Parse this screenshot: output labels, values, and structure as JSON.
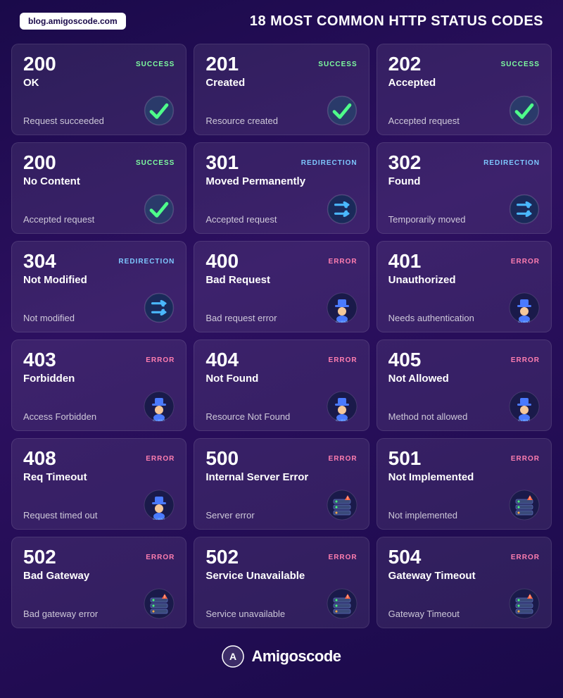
{
  "header": {
    "blog": "blog.amigoscode.com",
    "title": "18 MOST COMMON HTTP STATUS CODES"
  },
  "cards": [
    {
      "code": "200",
      "type": "SUCCESS",
      "typeClass": "type-success",
      "name": "OK",
      "desc": "Request succeeded",
      "icon": "check"
    },
    {
      "code": "201",
      "type": "SUCCESS",
      "typeClass": "type-success",
      "name": "Created",
      "desc": "Resource created",
      "icon": "check"
    },
    {
      "code": "202",
      "type": "SUCCESS",
      "typeClass": "type-success",
      "name": "Accepted",
      "desc": "Accepted request",
      "icon": "check"
    },
    {
      "code": "200",
      "type": "SUCCESS",
      "typeClass": "type-success",
      "name": "No Content",
      "desc": "Accepted request",
      "icon": "check"
    },
    {
      "code": "301",
      "type": "REDIRECTION",
      "typeClass": "type-redirection",
      "name": "Moved Permanently",
      "desc": "Accepted request",
      "icon": "shuffle"
    },
    {
      "code": "302",
      "type": "REDIRECTION",
      "typeClass": "type-redirection",
      "name": "Found",
      "desc": "Temporarily moved",
      "icon": "shuffle"
    },
    {
      "code": "304",
      "type": "REDIRECTION",
      "typeClass": "type-redirection",
      "name": "Not Modified",
      "desc": "Not modified",
      "icon": "shuffle"
    },
    {
      "code": "400",
      "type": "ERROR",
      "typeClass": "type-error",
      "name": "Bad Request",
      "desc": "Bad request error",
      "icon": "client"
    },
    {
      "code": "401",
      "type": "ERROR",
      "typeClass": "type-error",
      "name": "Unauthorized",
      "desc": "Needs authentication",
      "icon": "client"
    },
    {
      "code": "403",
      "type": "ERROR",
      "typeClass": "type-error",
      "name": "Forbidden",
      "desc": "Access Forbidden",
      "icon": "client"
    },
    {
      "code": "404",
      "type": "ERROR",
      "typeClass": "type-error",
      "name": "Not Found",
      "desc": "Resource Not Found",
      "icon": "client"
    },
    {
      "code": "405",
      "type": "ERROR",
      "typeClass": "type-error",
      "name": "Not Allowed",
      "desc": "Method not allowed",
      "icon": "client"
    },
    {
      "code": "408",
      "type": "ERROR",
      "typeClass": "type-error",
      "name": "Req Timeout",
      "desc": "Request timed out",
      "icon": "client"
    },
    {
      "code": "500",
      "type": "ERROR",
      "typeClass": "type-error",
      "name": "Internal Server Error",
      "desc": "Server error",
      "icon": "server"
    },
    {
      "code": "501",
      "type": "ERROR",
      "typeClass": "type-error",
      "name": "Not Implemented",
      "desc": "Not implemented",
      "icon": "server"
    },
    {
      "code": "502",
      "type": "ERROR",
      "typeClass": "type-error",
      "name": "Bad Gateway",
      "desc": "Bad gateway error",
      "icon": "server"
    },
    {
      "code": "502",
      "type": "ERROR",
      "typeClass": "type-error",
      "name": "Service Unavailable",
      "desc": "Service unavailable",
      "icon": "server"
    },
    {
      "code": "504",
      "type": "ERROR",
      "typeClass": "type-error",
      "name": "Gateway Timeout",
      "desc": "Gateway Timeout",
      "icon": "server"
    }
  ],
  "footer": {
    "brand": "Amigoscode"
  }
}
